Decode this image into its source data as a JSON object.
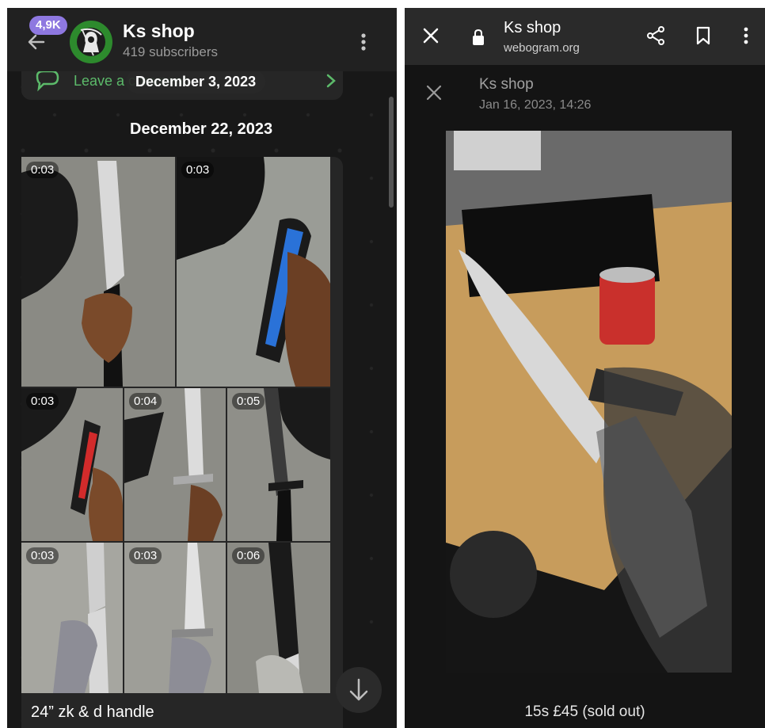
{
  "left_panel": {
    "header": {
      "unread_badge": "4,9K",
      "channel_title": "Ks shop",
      "subscribers": "419 subscribers",
      "avatar_icon": "reaper-logo",
      "menu_icon": "more-vertical-icon"
    },
    "comment_bar": {
      "label": "Leave a comment"
    },
    "date_separators": [
      "December 3, 2023",
      "December 22, 2023"
    ],
    "media": [
      {
        "duration": "0:03",
        "subject": "machete"
      },
      {
        "duration": "0:03",
        "subject": "blue folding knife"
      },
      {
        "duration": "0:03",
        "subject": "red folding knife"
      },
      {
        "duration": "0:04",
        "subject": "survival knife"
      },
      {
        "duration": "0:05",
        "subject": "machete"
      },
      {
        "duration": "0:03",
        "subject": "knife in gloved hand"
      },
      {
        "duration": "0:03",
        "subject": "knife in gloved hand"
      },
      {
        "duration": "0:06",
        "subject": "machete"
      }
    ],
    "caption": "24” zk & d handle",
    "scroll_down_icon": "arrow-down-icon"
  },
  "right_panel": {
    "browser_bar": {
      "title": "Ks shop",
      "url": "webogram.org",
      "icons": [
        "close-icon",
        "lock-icon",
        "share-icon",
        "bookmark-icon",
        "more-vertical-icon"
      ]
    },
    "viewer": {
      "channel": "Ks shop",
      "date": "Jan 16, 2023, 14:26",
      "caption": "15s £45 (sold out)"
    }
  },
  "colors": {
    "accent_green": "#5cba6a",
    "badge_purple": "#8e78e0",
    "dark_bg": "#181818",
    "header_bg": "#212121"
  }
}
